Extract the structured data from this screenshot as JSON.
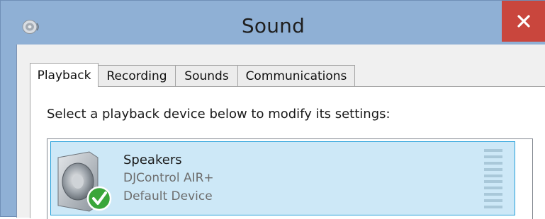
{
  "window": {
    "title": "Sound",
    "title_icon": "speaker-icon",
    "close_icon": "close-icon",
    "colors": {
      "titlebar": "#8fb0d5",
      "close": "#c9463d",
      "selection": "#cde8f7",
      "selection_border": "#26a0da"
    }
  },
  "tabs": [
    {
      "label": "Playback",
      "active": true
    },
    {
      "label": "Recording",
      "active": false
    },
    {
      "label": "Sounds",
      "active": false
    },
    {
      "label": "Communications",
      "active": false
    }
  ],
  "playback": {
    "instruction": "Select a playback device below to modify its settings:",
    "devices": [
      {
        "name": "Speakers",
        "description": "DJControl AIR+",
        "status": "Default Device",
        "icon": "speaker-device-icon",
        "badge_icon": "default-check-icon",
        "selected": true
      }
    ]
  }
}
